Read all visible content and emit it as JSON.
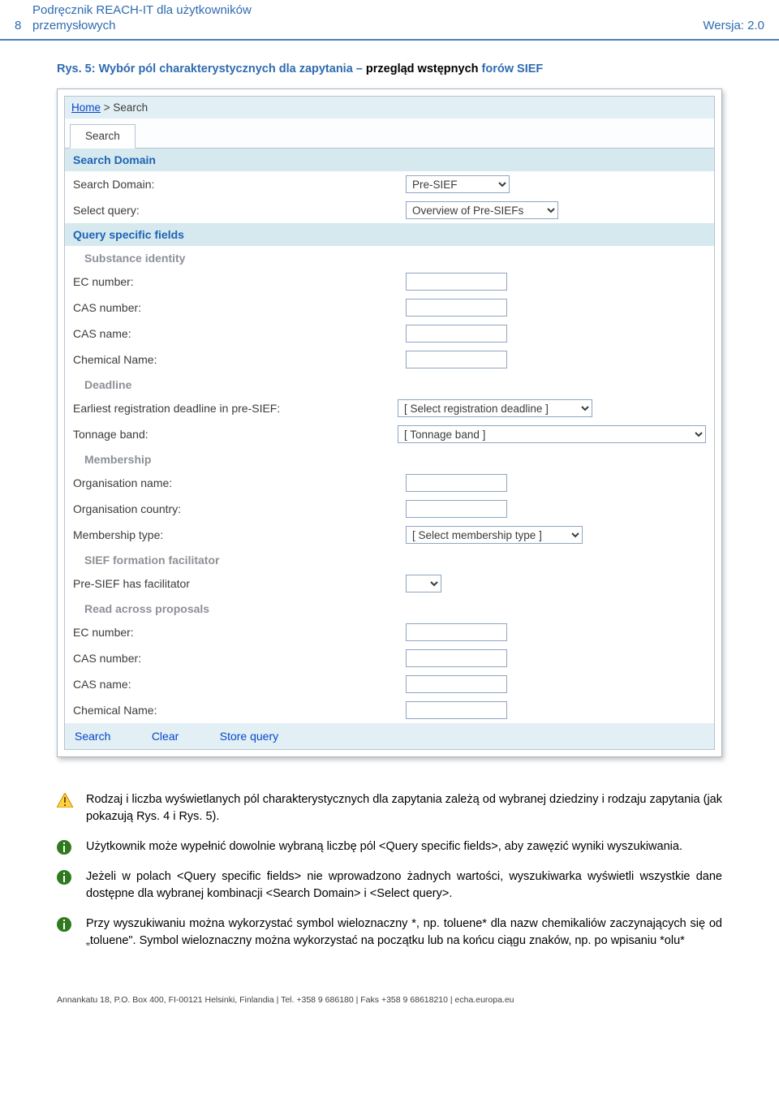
{
  "header": {
    "page_num": "8",
    "title_line1": "Podręcznik REACH-IT dla użytkowników",
    "title_line2": "przemysłowych",
    "version": "Wersja: 2.0"
  },
  "figure_caption_prefix": "Rys. 5: Wybór pól charakterystycznych dla zapytania – ",
  "figure_caption_bold": "przegląd wstępnych ",
  "figure_caption_suffix": "forów SIEF",
  "breadcrumb": {
    "home": "Home",
    "sep": " > ",
    "current": "Search"
  },
  "tab": "Search",
  "sections": {
    "search_domain_title": "Search Domain",
    "search_domain_label": "Search Domain:",
    "search_domain_value": "Pre-SIEF",
    "select_query_label": "Select query:",
    "select_query_value": "Overview of Pre-SIEFs",
    "query_specific_title": "Query specific fields",
    "substance_identity": "Substance identity",
    "ec_number": "EC number:",
    "cas_number": "CAS number:",
    "cas_name": "CAS name:",
    "chemical_name": "Chemical Name:",
    "deadline": "Deadline",
    "earliest_deadline": "Earliest registration deadline in pre-SIEF:",
    "earliest_deadline_value": "[ Select registration deadline ]",
    "tonnage_band": "Tonnage band:",
    "tonnage_band_value": "[ Tonnage band ]",
    "membership": "Membership",
    "org_name": "Organisation name:",
    "org_country": "Organisation country:",
    "membership_type": "Membership type:",
    "membership_type_value": "[ Select membership type ]",
    "sief_facilitator": "SIEF formation facilitator",
    "has_facilitator": "Pre-SIEF has facilitator",
    "read_across": "Read across proposals",
    "ec_number2": "EC number:",
    "cas_number2": "CAS number:",
    "cas_name2": "CAS name:",
    "chemical_name2": "Chemical Name:"
  },
  "buttons": {
    "search": "Search",
    "clear": "Clear",
    "store": "Store query"
  },
  "notes": {
    "n1": "Rodzaj i liczba wyświetlanych pól charakterystycznych dla zapytania zależą od wybranej dziedziny i rodzaju zapytania (jak pokazują Rys. 4 i Rys. 5).",
    "n2": "Użytkownik może wypełnić dowolnie wybraną liczbę pól <Query specific fields>, aby zawęzić wyniki wyszukiwania.",
    "n3": "Jeżeli w polach <Query specific fields> nie wprowadzono żadnych wartości, wyszukiwarka wyświetli wszystkie dane dostępne dla wybranej kombinacji <Search Domain> i <Select query>.",
    "n4": "Przy wyszukiwaniu można wykorzystać symbol wieloznaczny *, np. toluene* dla nazw chemikaliów zaczynających się od „toluene\". Symbol wieloznaczny można wykorzystać na początku lub na końcu ciągu znaków, np. po wpisaniu *olu*"
  },
  "footer": "Annankatu 18, P.O. Box 400, FI-00121 Helsinki, Finlandia | Tel. +358 9 686180 | Faks +358 9 68618210 | echa.europa.eu"
}
